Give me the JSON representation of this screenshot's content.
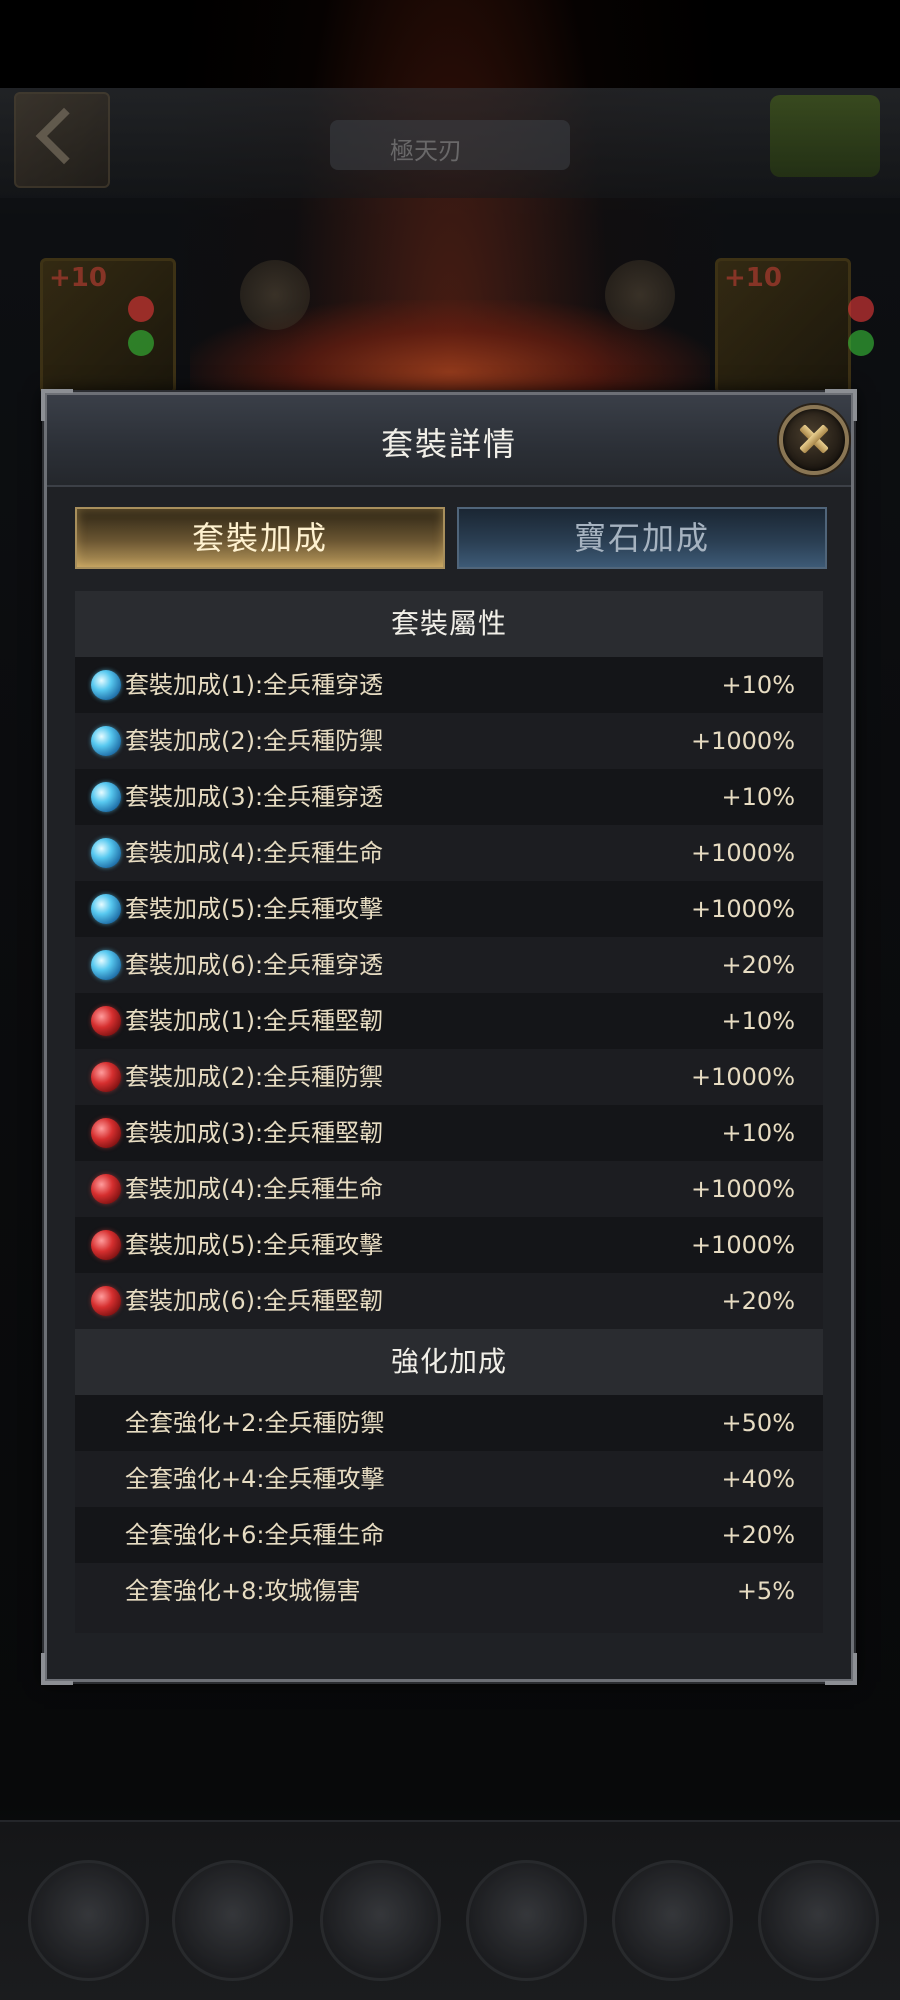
{
  "background": {
    "screen_title": "極天刃",
    "slot_badge": "+10"
  },
  "dialog": {
    "title": "套裝詳情",
    "tabs": [
      {
        "label": "套裝加成",
        "active": true
      },
      {
        "label": "寶石加成",
        "active": false
      }
    ],
    "set_section": {
      "header": "套裝屬性",
      "rows": [
        {
          "icon": "blue-gem-icon",
          "label": "套裝加成(1):全兵種穿透",
          "value": "+10%"
        },
        {
          "icon": "blue-gem-icon",
          "label": "套裝加成(2):全兵種防禦",
          "value": "+1000%"
        },
        {
          "icon": "blue-gem-icon",
          "label": "套裝加成(3):全兵種穿透",
          "value": "+10%"
        },
        {
          "icon": "blue-gem-icon",
          "label": "套裝加成(4):全兵種生命",
          "value": "+1000%"
        },
        {
          "icon": "blue-gem-icon",
          "label": "套裝加成(5):全兵種攻擊",
          "value": "+1000%"
        },
        {
          "icon": "blue-gem-icon",
          "label": "套裝加成(6):全兵種穿透",
          "value": "+20%"
        },
        {
          "icon": "red-gem-icon",
          "label": "套裝加成(1):全兵種堅韌",
          "value": "+10%"
        },
        {
          "icon": "red-gem-icon",
          "label": "套裝加成(2):全兵種防禦",
          "value": "+1000%"
        },
        {
          "icon": "red-gem-icon",
          "label": "套裝加成(3):全兵種堅韌",
          "value": "+10%"
        },
        {
          "icon": "red-gem-icon",
          "label": "套裝加成(4):全兵種生命",
          "value": "+1000%"
        },
        {
          "icon": "red-gem-icon",
          "label": "套裝加成(5):全兵種攻擊",
          "value": "+1000%"
        },
        {
          "icon": "red-gem-icon",
          "label": "套裝加成(6):全兵種堅韌",
          "value": "+20%"
        }
      ]
    },
    "enhance_section": {
      "header": "強化加成",
      "rows": [
        {
          "label": "全套強化+2:全兵種防禦",
          "value": "+50%"
        },
        {
          "label": "全套強化+4:全兵種攻擊",
          "value": "+40%"
        },
        {
          "label": "全套強化+6:全兵種生命",
          "value": "+20%"
        },
        {
          "label": "全套強化+8:攻城傷害",
          "value": "+5%"
        }
      ]
    }
  }
}
